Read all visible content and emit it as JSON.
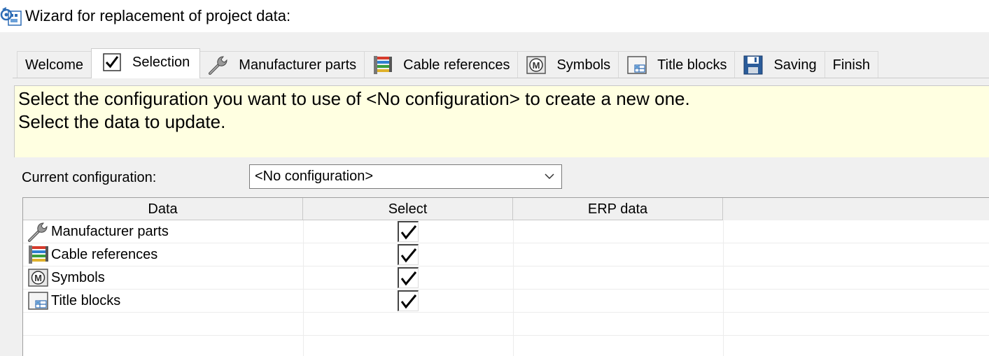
{
  "window": {
    "title": "Wizard for replacement of project data:",
    "icon": "wizard-replace-icon"
  },
  "tabs": [
    {
      "label": "Welcome",
      "icon": null,
      "active": false
    },
    {
      "label": "Selection",
      "icon": "check-icon",
      "active": true
    },
    {
      "label": "Manufacturer parts",
      "icon": "wrench-icon",
      "active": false
    },
    {
      "label": "Cable references",
      "icon": "cable-icon",
      "active": false
    },
    {
      "label": "Symbols",
      "icon": "symbol-m-icon",
      "active": false
    },
    {
      "label": "Title blocks",
      "icon": "title-block-icon",
      "active": false
    },
    {
      "label": "Saving",
      "icon": "floppy-disk-icon",
      "active": false
    },
    {
      "label": "Finish",
      "icon": null,
      "active": false
    }
  ],
  "info": {
    "line1": "Select the configuration you want to use of <No configuration> to create a new one.",
    "line2": "Select the data to update.",
    "background": "#ffffe1"
  },
  "config": {
    "label": "Current configuration:",
    "value": "<No configuration>"
  },
  "grid": {
    "columns": [
      "Data",
      "Select",
      "ERP data"
    ],
    "rows": [
      {
        "data": "Manufacturer parts",
        "icon": "wrench-icon",
        "select": true,
        "erp": ""
      },
      {
        "data": "Cable references",
        "icon": "cable-icon",
        "select": true,
        "erp": ""
      },
      {
        "data": "Symbols",
        "icon": "symbol-m-icon",
        "select": true,
        "erp": ""
      },
      {
        "data": "Title blocks",
        "icon": "title-block-icon",
        "select": true,
        "erp": ""
      }
    ]
  }
}
